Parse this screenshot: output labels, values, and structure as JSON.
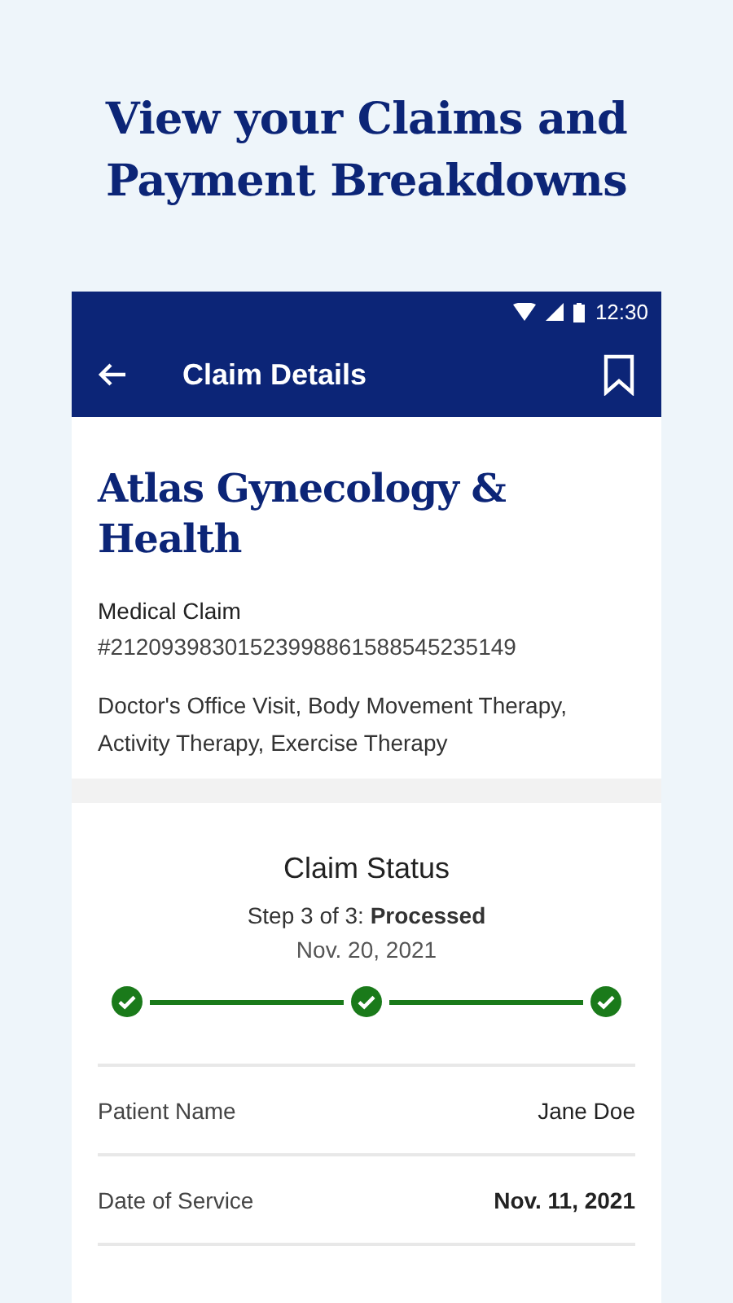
{
  "headline": "View your Claims and Payment Breakdowns",
  "status_bar": {
    "time": "12:30"
  },
  "app_bar": {
    "title": "Claim Details"
  },
  "provider": {
    "name": "Atlas Gynecology & Health",
    "claim_type": "Medical Claim",
    "claim_number": "#21209398301523998861588545235149",
    "services": "Doctor's Office Visit, Body Movement Therapy, Activity Therapy, Exercise Therapy"
  },
  "claim_status": {
    "title": "Claim Status",
    "step": "Step 3 of 3: **Processed**",
    "date": "Nov. 20, 2021",
    "steps": [
      {
        "done": true
      },
      {
        "done": true
      },
      {
        "done": true
      }
    ]
  },
  "details": [
    {
      "label": "Patient Name",
      "value": "Jane Doe"
    },
    {
      "label": "Date of Service",
      "value": "Nov. 11, 2021"
    }
  ]
}
